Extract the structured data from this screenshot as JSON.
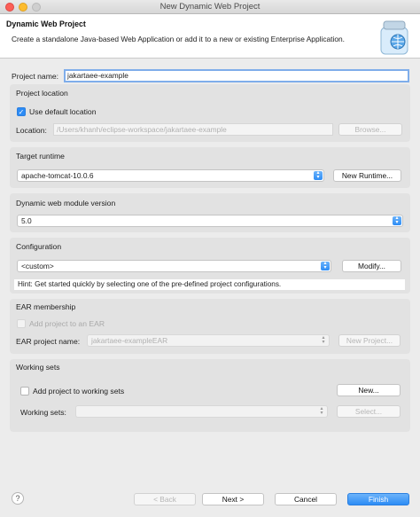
{
  "window": {
    "title": "New Dynamic Web Project"
  },
  "header": {
    "title": "Dynamic Web Project",
    "description": "Create a standalone Java-based Web Application or add it to a new or existing Enterprise Application."
  },
  "project": {
    "name_label": "Project name:",
    "name_value": "jakartaee-example"
  },
  "location": {
    "section": "Project location",
    "use_default_label": "Use default location",
    "location_label": "Location:",
    "location_value": "/Users/khanh/eclipse-workspace/jakartaee-example",
    "browse_label": "Browse..."
  },
  "runtime": {
    "section": "Target runtime",
    "selected": "apache-tomcat-10.0.6",
    "new_runtime_label": "New Runtime..."
  },
  "module": {
    "section": "Dynamic web module version",
    "selected": "5.0"
  },
  "configuration": {
    "section": "Configuration",
    "selected": "<custom>",
    "modify_label": "Modify...",
    "hint": "Hint: Get started quickly by selecting one of the pre-defined project configurations."
  },
  "ear": {
    "section": "EAR membership",
    "add_label": "Add project to an EAR",
    "project_name_label": "EAR project name:",
    "project_name_value": "jakartaee-exampleEAR",
    "new_project_label": "New Project..."
  },
  "working_sets": {
    "section": "Working sets",
    "add_label": "Add project to working sets",
    "new_label": "New...",
    "sets_label": "Working sets:",
    "select_label": "Select..."
  },
  "footer": {
    "help": "?",
    "back_label": "< Back",
    "next_label": "Next >",
    "cancel_label": "Cancel",
    "finish_label": "Finish"
  },
  "colors": {
    "accent": "#2d8cf5",
    "focus_ring": "#7fadea"
  },
  "icons": {
    "header": "web-project-jar-icon",
    "checkbox_checked": "checkmark-icon",
    "select_arrows": "up-down-chevron-icon"
  }
}
